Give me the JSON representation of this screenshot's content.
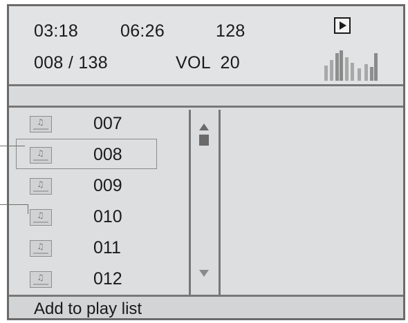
{
  "status": {
    "elapsed": "03:18",
    "total": "06:26",
    "bitrate": "128",
    "track_position": "008 / 138",
    "volume": "VOL  20",
    "play_state_icon": "play-icon",
    "equalizer_icon": "equalizer-icon"
  },
  "title_bar": "",
  "playlist": {
    "items": [
      {
        "number": "007",
        "icon": "music-file-icon"
      },
      {
        "number": "008",
        "icon": "music-file-icon"
      },
      {
        "number": "009",
        "icon": "music-file-icon"
      },
      {
        "number": "010",
        "icon": "music-file-icon"
      },
      {
        "number": "011",
        "icon": "music-file-icon"
      },
      {
        "number": "012",
        "icon": "music-file-icon"
      }
    ],
    "selected": "008"
  },
  "scrollbar": {
    "up_icon": "scroll-up-arrow-icon",
    "down_icon": "scroll-down-arrow-icon"
  },
  "action_bar": {
    "label": "Add to play list"
  }
}
